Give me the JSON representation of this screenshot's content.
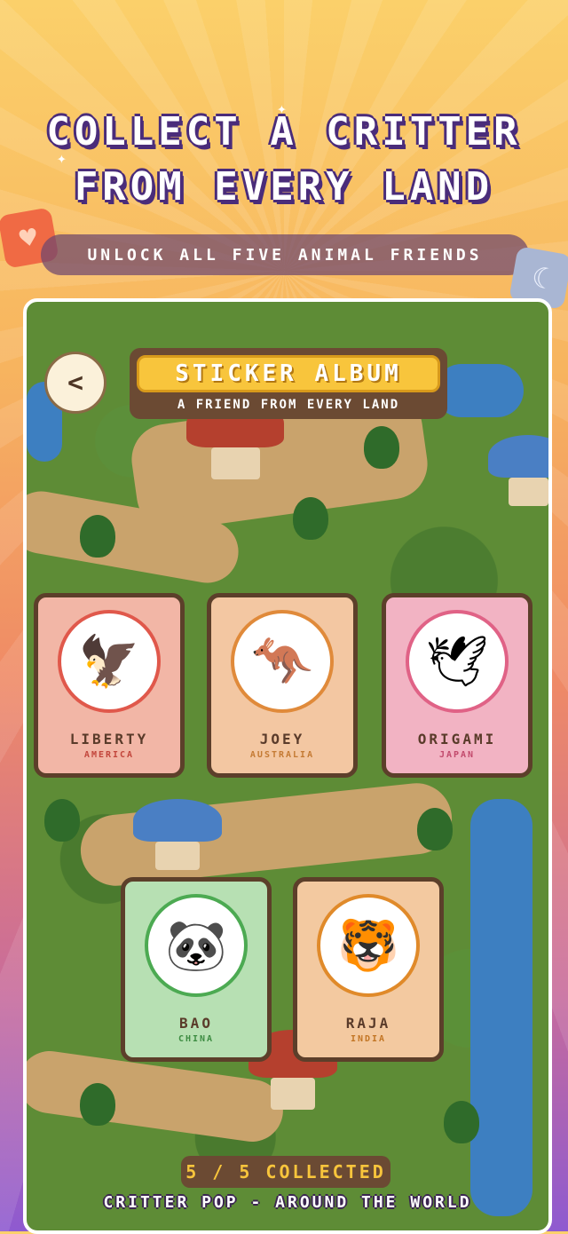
{
  "headline": {
    "line1": "COLLECT A CRITTER",
    "line2": "FROM EVERY LAND"
  },
  "subtitle": "UNLOCK ALL FIVE ANIMAL FRIENDS",
  "album": {
    "back_icon": "<",
    "title": "STICKER ALBUM",
    "subtitle": "A FRIEND FROM EVERY LAND"
  },
  "cards": [
    {
      "name": "LIBERTY",
      "land": "AMERICA",
      "animal": "eagle",
      "emoji": "🦅",
      "bg": "#f2b6a6",
      "ring": "#e0584b",
      "land_color": "#c2463c"
    },
    {
      "name": "JOEY",
      "land": "AUSTRALIA",
      "animal": "kangaroo",
      "emoji": "🦘",
      "bg": "#f3c7a2",
      "ring": "#e08a3a",
      "land_color": "#c47a33"
    },
    {
      "name": "ORIGAMI",
      "land": "JAPAN",
      "animal": "crane",
      "emoji": "🕊",
      "bg": "#f2b3c3",
      "ring": "#e06286",
      "land_color": "#c24a6c"
    },
    {
      "name": "BAO",
      "land": "CHINA",
      "animal": "panda",
      "emoji": "🐼",
      "bg": "#b7e0b3",
      "ring": "#4caa52",
      "land_color": "#3d8c42"
    },
    {
      "name": "RAJA",
      "land": "INDIA",
      "animal": "tiger",
      "emoji": "🐯",
      "bg": "#f3c9a0",
      "ring": "#e08a2a",
      "land_color": "#c27524"
    }
  ],
  "progress": {
    "label": "5 / 5 COLLECTED",
    "collected": 5,
    "total": 5
  },
  "footer": "CRITTER POP  -  AROUND THE WORLD",
  "decor": {
    "heart_icon": "♥",
    "moon_icon": "☾",
    "sparkle_icon": "✦"
  }
}
